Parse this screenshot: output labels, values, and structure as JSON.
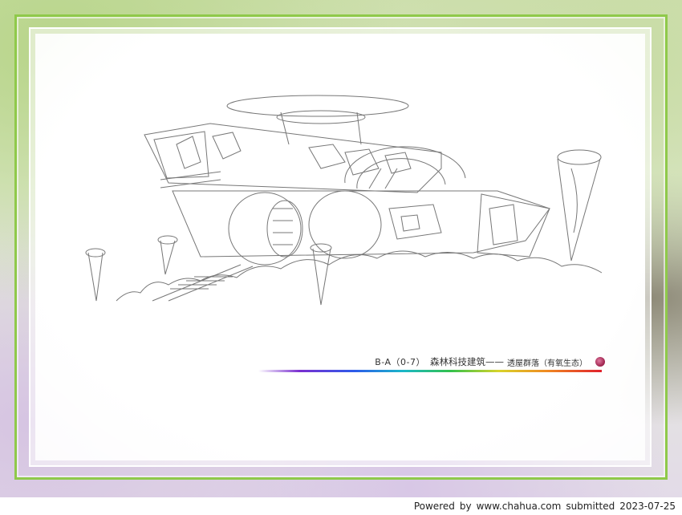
{
  "caption": {
    "code": "B-A（0-7）",
    "title": "森林科技建筑——",
    "subtitle": "透屋群落（有氧生态）",
    "dot_color": "#9c1f4a"
  },
  "footer": {
    "powered": "Powered",
    "by": "by",
    "site": "www.chahua.com",
    "submitted": "submitted",
    "date": "2023-07-25"
  },
  "colors": {
    "frame": "#8fc94a",
    "line_art": "#777777"
  }
}
